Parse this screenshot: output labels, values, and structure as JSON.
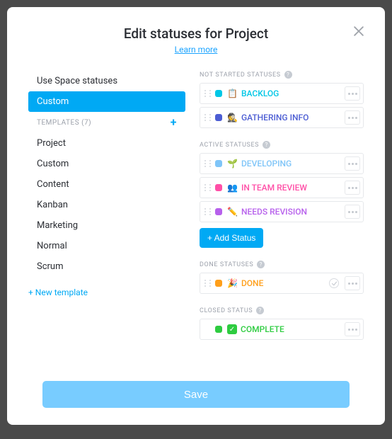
{
  "header": {
    "title": "Edit statuses for Project",
    "learn_more": "Learn more"
  },
  "sidebar": {
    "use_space": "Use Space statuses",
    "custom": "Custom",
    "templates_header": "TEMPLATES (7)",
    "templates": [
      "Project",
      "Custom",
      "Content",
      "Kanban",
      "Marketing",
      "Normal",
      "Scrum"
    ],
    "new_template": "+ New template"
  },
  "sections": {
    "not_started": {
      "header": "NOT STARTED STATUSES",
      "items": [
        {
          "color": "#00c7e6",
          "emoji": "📋",
          "label": "BACKLOG",
          "label_color": "#00c7e6"
        },
        {
          "color": "#4c5dd3",
          "emoji": "🕵️",
          "label": "GATHERING INFO",
          "label_color": "#4c5dd3"
        }
      ]
    },
    "active": {
      "header": "ACTIVE STATUSES",
      "items": [
        {
          "color": "#7fc5f8",
          "emoji": "🌱",
          "label": "DEVELOPING",
          "label_color": "#7fc5f8"
        },
        {
          "color": "#ff4fa7",
          "emoji": "👥",
          "label": "IN TEAM REVIEW",
          "label_color": "#ff4fa7"
        },
        {
          "color": "#b760ec",
          "emoji": "✏️",
          "label": "NEEDS REVISION",
          "label_color": "#b760ec"
        }
      ],
      "add_button": "+ Add Status"
    },
    "done": {
      "header": "DONE STATUSES",
      "items": [
        {
          "color": "#ff9f1a",
          "emoji": "🎉",
          "label": "DONE",
          "label_color": "#ff9f1a"
        }
      ]
    },
    "closed": {
      "header": "CLOSED STATUS",
      "items": [
        {
          "color": "#2ecc40",
          "label": "COMPLETE",
          "label_color": "#2ecc40"
        }
      ]
    }
  },
  "save": "Save"
}
